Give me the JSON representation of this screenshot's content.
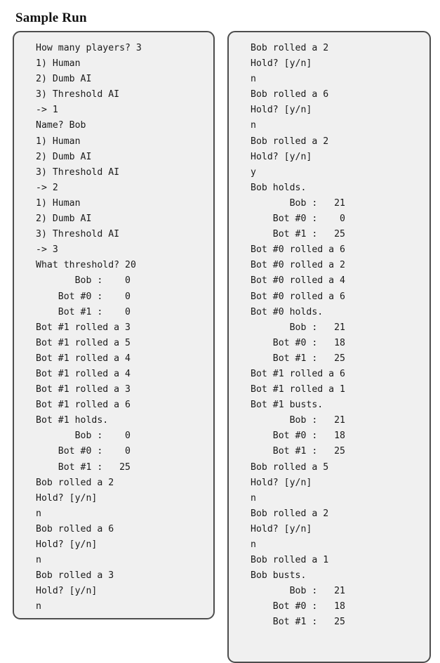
{
  "page": {
    "title": "Sample Run"
  },
  "panels": [
    {
      "name": "left-console-panel",
      "lines": [
        "How many players? 3",
        "1) Human",
        "2) Dumb AI",
        "3) Threshold AI",
        "-> 1",
        "Name? Bob",
        "1) Human",
        "2) Dumb AI",
        "3) Threshold AI",
        "-> 2",
        "1) Human",
        "2) Dumb AI",
        "3) Threshold AI",
        "-> 3",
        "What threshold? 20",
        "       Bob :    0",
        "    Bot #0 :    0",
        "    Bot #1 :    0",
        "Bot #1 rolled a 3",
        "Bot #1 rolled a 5",
        "Bot #1 rolled a 4",
        "Bot #1 rolled a 4",
        "Bot #1 rolled a 3",
        "Bot #1 rolled a 6",
        "Bot #1 holds.",
        "       Bob :    0",
        "    Bot #0 :    0",
        "    Bot #1 :   25",
        "Bob rolled a 2",
        "Hold? [y/n]",
        "n",
        "Bob rolled a 6",
        "Hold? [y/n]",
        "n",
        "Bob rolled a 3",
        "Hold? [y/n]",
        "n"
      ]
    },
    {
      "name": "right-console-panel",
      "lines": [
        "Bob rolled a 2",
        "Hold? [y/n]",
        "n",
        "Bob rolled a 6",
        "Hold? [y/n]",
        "n",
        "Bob rolled a 2",
        "Hold? [y/n]",
        "y",
        "Bob holds.",
        "       Bob :   21",
        "    Bot #0 :    0",
        "    Bot #1 :   25",
        "Bot #0 rolled a 6",
        "Bot #0 rolled a 2",
        "Bot #0 rolled a 4",
        "Bot #0 rolled a 6",
        "Bot #0 holds.",
        "       Bob :   21",
        "    Bot #0 :   18",
        "    Bot #1 :   25",
        "Bot #1 rolled a 6",
        "Bot #1 rolled a 1",
        "Bot #1 busts.",
        "       Bob :   21",
        "    Bot #0 :   18",
        "    Bot #1 :   25",
        "Bob rolled a 5",
        "Hold? [y/n]",
        "n",
        "Bob rolled a 2",
        "Hold? [y/n]",
        "n",
        "Bob rolled a 1",
        "Bob busts.",
        "       Bob :   21",
        "    Bot #0 :   18",
        "    Bot #1 :   25"
      ]
    }
  ],
  "colors": {
    "panel_background": "#f0f0f0",
    "panel_border": "#4d4d4d",
    "text": "#1a1a1a",
    "page_background": "#ffffff"
  }
}
